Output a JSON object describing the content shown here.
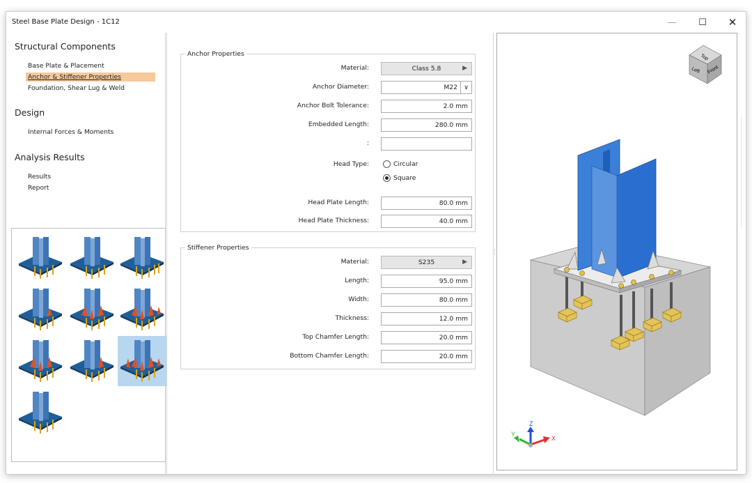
{
  "window": {
    "title": "Steel Base Plate Design - 1C12",
    "min_glyph": "—",
    "max_glyph": "☐",
    "close_glyph": "✕"
  },
  "sidebar": {
    "sections": [
      {
        "title": "Structural Components",
        "items": [
          "Base Plate & Placement",
          "Anchor & Stiffener Properties",
          "Foundation, Shear Lug & Weld"
        ]
      },
      {
        "title": "Design",
        "items": [
          "Internal Forces & Moments"
        ]
      },
      {
        "title": "Analysis Results",
        "items": [
          "Results",
          "Report"
        ]
      }
    ],
    "active_item": "Anchor & Stiffener Properties",
    "thumbnails_selected_index": 8
  },
  "anchor": {
    "title": "Anchor Properties",
    "material_label": "Material:",
    "material_value": "Class 5.8",
    "diameter_label": "Anchor Diameter:",
    "diameter_value": "M22",
    "tolerance_label": "Anchor Bolt Tolerance:",
    "tolerance_value": "2.0 mm",
    "embedded_label": "Embedded Length:",
    "embedded_value": "280.0 mm",
    "blank_label": ":",
    "blank_value": "",
    "headtype_label": "Head Type:",
    "head_options": [
      "Circular",
      "Square"
    ],
    "head_selected": "Square",
    "hp_length_label": "Head Plate Length:",
    "hp_length_value": "80.0 mm",
    "hp_thick_label": "Head Plate Thickness:",
    "hp_thick_value": "40.0 mm"
  },
  "stiffener": {
    "title": "Stiffener Properties",
    "material_label": "Material:",
    "material_value": "S235",
    "length_label": "Length:",
    "length_value": "95.0 mm",
    "width_label": "Width:",
    "width_value": "80.0 mm",
    "thickness_label": "Thickness:",
    "thickness_value": "12.0 mm",
    "top_chamfer_label": "Top Chamfer Length:",
    "top_chamfer_value": "20.0 mm",
    "bottom_chamfer_label": "Bottom Chamfer Length:",
    "bottom_chamfer_value": "20.0 mm"
  },
  "viewer": {
    "cube_top": "Top",
    "cube_left": "Left",
    "cube_front": "Front",
    "axis_x": "X",
    "axis_y": "Y",
    "axis_z": "Z",
    "colors": {
      "column": "#2a6fd0",
      "concrete": "#c9c9c9",
      "plate": "#e8e8e8",
      "head_plate": "#e3c35a",
      "axis_x": "#e53030",
      "axis_y": "#2eb82e",
      "axis_z": "#1f4fe0"
    }
  }
}
